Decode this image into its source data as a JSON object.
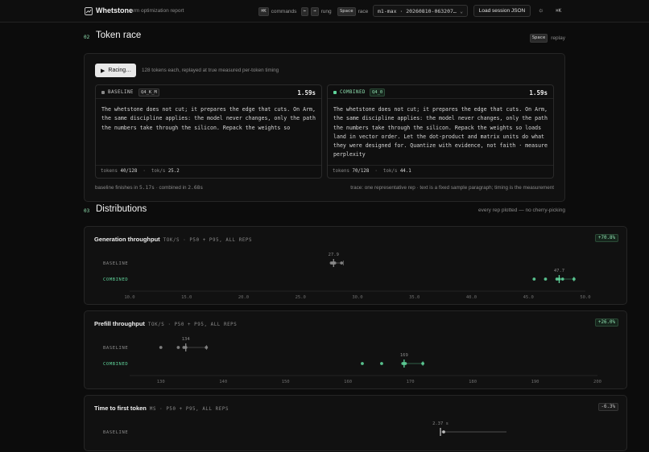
{
  "topbar": {
    "brand": "Whetstone",
    "subtitle": "arm optimization report",
    "hint_commands_key": "⌘K",
    "hint_commands": "commands",
    "hint_rung_key_left": "←",
    "hint_rung_key_right": "→",
    "hint_rung": "rung",
    "hint_race_key": "Space",
    "hint_race": "race",
    "session_select": "m1-max · 20260810-063207…",
    "load_button": "Load session JSON",
    "theme_icon": "sun-icon",
    "shortcut_label": "⌘K"
  },
  "race": {
    "num": "02",
    "title": "Token race",
    "replay_key": "Space",
    "replay_label": "replay",
    "button_label": "Racing…",
    "note": "128 tokens each, replayed at true measured per-token timing",
    "baseline": {
      "label": "BASELINE",
      "quant": "Q4_K_M",
      "time": "1.59s",
      "text": "The whetstone does not cut; it prepares the edge that cuts. On Arm, the same discipline applies: the model never changes, only the path the numbers take through the silicon. Repack the weights so",
      "tokens_label": "tokens",
      "tokens": "40/128",
      "tps_label": "tok/s",
      "tps": "25.2",
      "color": "#8a8a8a"
    },
    "combined": {
      "label": "COMBINED",
      "quant": "Q4_0",
      "time": "1.59s",
      "text": "The whetstone does not cut; it prepares the edge that cuts. On Arm, the same discipline applies: the model never changes, only the path the numbers take through the silicon. Repack the weights so loads land in vector order. Let the dot-product and matrix units do what they were designed for. Quantize with evidence, not faith · measure perplexity",
      "tokens_label": "tokens",
      "tokens": "70/128",
      "tps_label": "tok/s",
      "tps": "44.1",
      "color": "#5fd39a"
    },
    "summary_prefix": "baseline finishes in",
    "summary_base": "5.17s",
    "summary_mid": "· combined in",
    "summary_comb": "2.68s",
    "trace": "trace: one representative rep · text is a fixed sample paragraph; timing is the measurement"
  },
  "distributions": {
    "num": "03",
    "title": "Distributions",
    "note": "every rep plotted — no cherry-picking",
    "charts": [
      {
        "title": "Generation throughput",
        "subtitle": "TOK/S · P50 + P95, ALL REPS",
        "badge": "+70.8%",
        "row_baseline": "BASELINE",
        "row_combined": "COMBINED",
        "baseline_label": "27.9",
        "combined_label": "47.7",
        "ticks": [
          "10.0",
          "15.0",
          "20.0",
          "25.0",
          "30.0",
          "35.0",
          "40.0",
          "45.0",
          "50.0"
        ]
      },
      {
        "title": "Prefill throughput",
        "subtitle": "TOK/S · P50 + P95, ALL REPS",
        "badge": "+26.0%",
        "row_baseline": "BASELINE",
        "row_combined": "COMBINED",
        "baseline_label": "134",
        "combined_label": "169",
        "ticks": [
          "130",
          "140",
          "150",
          "160",
          "170",
          "180",
          "190",
          "200"
        ]
      },
      {
        "title": "Time to first token",
        "subtitle": "MS · P50 + P95, ALL REPS",
        "badge": "-6.3%",
        "row_baseline": "BASELINE",
        "baseline_label": "2.37 s"
      }
    ]
  },
  "chart_data": [
    {
      "type": "scatter",
      "title": "Generation throughput",
      "xlabel": "TOK/S",
      "xlim": [
        10,
        50
      ],
      "series": [
        {
          "name": "BASELINE",
          "p50": 27.9,
          "values": [
            27.7,
            27.8,
            27.9,
            28.0,
            28.6
          ],
          "color": "#8a8a8a"
        },
        {
          "name": "COMBINED",
          "p50": 47.7,
          "values": [
            45.5,
            46.5,
            47.5,
            47.7,
            48.0,
            49.0
          ],
          "color": "#5fd39a"
        }
      ]
    },
    {
      "type": "scatter",
      "title": "Prefill throughput",
      "xlabel": "TOK/S",
      "xlim": [
        125,
        200
      ],
      "series": [
        {
          "name": "BASELINE",
          "p50": 134,
          "values": [
            130.0,
            132.8,
            133.7,
            134.0,
            137.3
          ],
          "color": "#8a8a8a"
        },
        {
          "name": "COMBINED",
          "p50": 169,
          "values": [
            162.3,
            165.4,
            168.8,
            169.2,
            172.0
          ],
          "color": "#5fd39a"
        }
      ]
    },
    {
      "type": "scatter",
      "title": "Time to first token",
      "xlabel": "MS",
      "series": [
        {
          "name": "BASELINE",
          "p50": 2.37,
          "color": "#8a8a8a"
        }
      ]
    }
  ]
}
